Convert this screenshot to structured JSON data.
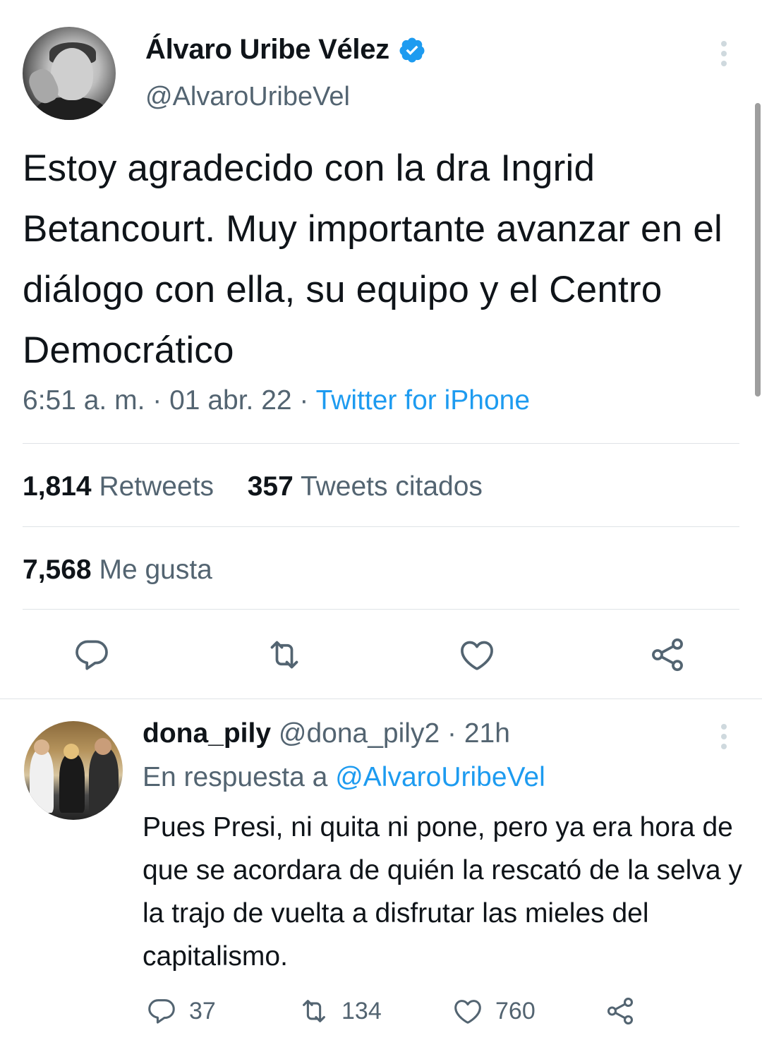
{
  "tweet": {
    "author_name": "Álvaro Uribe Vélez",
    "author_handle": "@AlvaroUribeVel",
    "text": "Estoy agradecido con la dra Ingrid Betancourt. Muy importante avanzar en el diálogo con ella, su equipo y el Centro Democrático",
    "time": "6:51 a. m.",
    "date": "01 abr. 22",
    "source": "Twitter for iPhone",
    "separator": " · ",
    "retweets_count": "1,814",
    "retweets_label": "Retweets",
    "quotes_count": "357",
    "quotes_label": "Tweets citados",
    "likes_count": "7,568",
    "likes_label": "Me gusta",
    "verified": true
  },
  "reply": {
    "author_name": "dona_pily",
    "author_handle": "@dona_pily2",
    "time_ago": "21h",
    "reply_to_prefix": "En respuesta a",
    "reply_to_mention": "@AlvaroUribeVel",
    "text": "Pues Presi, ni quita ni pone, pero ya era hora de que se acordara de quién la rescató de la selva y la trajo de vuelta a disfrutar las mieles del capitalismo.",
    "reply_count": "37",
    "retweet_count": "134",
    "like_count": "760"
  },
  "icons": {
    "verified": "verified-badge-icon",
    "more": "more-vertical-icon",
    "reply": "reply-icon",
    "retweet": "retweet-icon",
    "like": "heart-icon",
    "share": "share-icon"
  },
  "colors": {
    "accent": "#1d9bf0",
    "secondary_text": "#536471",
    "primary_text": "#0f1419",
    "divider": "#dfe3e6"
  }
}
